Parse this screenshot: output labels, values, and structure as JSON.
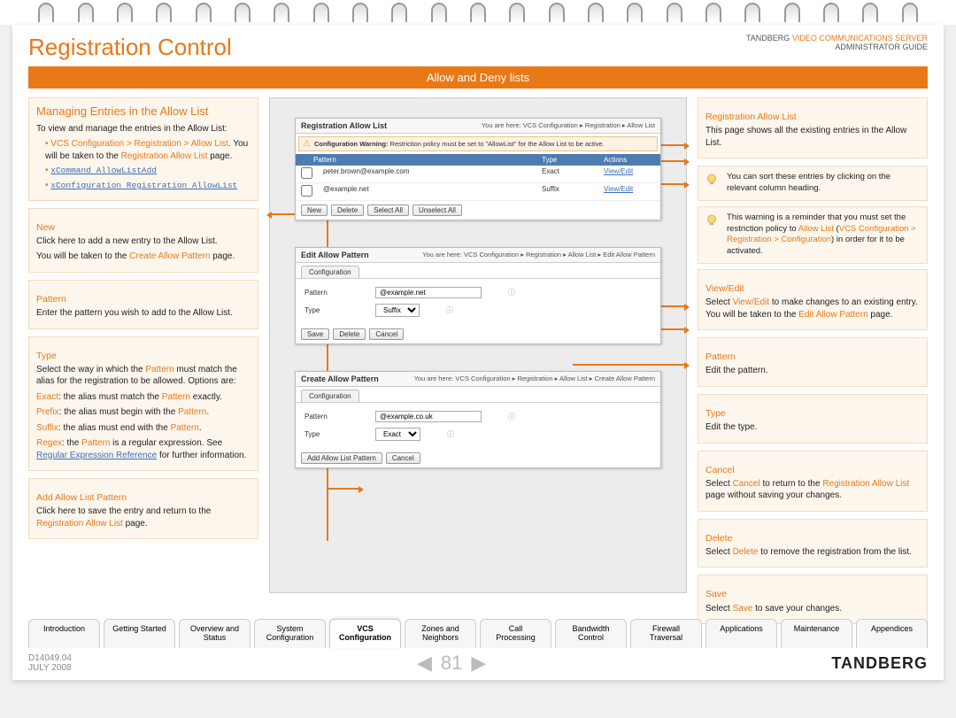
{
  "header": {
    "title": "Registration Control",
    "brand_line1_a": "TANDBERG ",
    "brand_line1_b": "VIDEO COMMUNICATIONS SERVER",
    "brand_line2": "ADMINISTRATOR GUIDE"
  },
  "bar": "Allow and Deny lists",
  "left": {
    "h": "Managing Entries in the Allow List",
    "intro": "To view and manage the entries in the Allow List:",
    "bullets": {
      "b1a": "VCS Configuration > Registration > Allow List",
      "b1b": ". You will be taken to the ",
      "b1c": "Registration Allow List",
      "b1d": " page.",
      "b2": "xCommand AllowListAdd",
      "b3": "xConfiguration Registration AllowList"
    },
    "new_h": "New",
    "new_p1": "Click here to add a new entry to the Allow List.",
    "new_p2a": "You will be taken to the ",
    "new_p2b": "Create Allow Pattern",
    "new_p2c": " page.",
    "pattern_h": "Pattern",
    "pattern_p": "Enter the pattern you wish to add to the Allow List.",
    "type_h": "Type",
    "type_p1a": "Select the way in which the ",
    "type_p1b": "Pattern",
    "type_p1c": " must match the alias for the registration to be allowed. Options are:",
    "exact_a": "Exact",
    "exact_b": ": the alias must match the ",
    "exact_c": "Pattern",
    "exact_d": " exactly.",
    "prefix_a": "Prefix",
    "prefix_b": ": the alias must begin with the ",
    "prefix_c": "Pattern",
    "prefix_d": ".",
    "suffix_a": "Suffix",
    "suffix_b": ": the alias must end with the ",
    "suffix_c": "Pattern",
    "suffix_d": ".",
    "regex_a": "Regex",
    "regex_b": ": the ",
    "regex_c": "Pattern",
    "regex_d": " is a regular expression. See ",
    "regex_link": "Regular Expression Reference",
    "regex_e": " for further information.",
    "add_h": "Add Allow List Pattern",
    "add_p1": "Click here to save the entry and return to the ",
    "add_p2": "Registration Allow List",
    "add_p3": " page."
  },
  "right": {
    "h": "Registration Allow List",
    "p1": "This page shows all the existing entries in the Allow List.",
    "tip1": "You can sort these entries by clicking on the relevant column heading.",
    "tip2a": "This warning is a reminder that you must set the restriction policy to ",
    "tip2b": "Allow List",
    "tip2c": " (",
    "tip2d": "VCS Configuration > Registration > Configuration",
    "tip2e": ") in order for it to be activated.",
    "ve_h": "View/Edit",
    "ve_a": "Select ",
    "ve_b": "View/Edit",
    "ve_c": " to make changes to an existing entry. You will be taken to the ",
    "ve_d": "Edit Allow Pattern",
    "ve_e": " page.",
    "pat_h": "Pattern",
    "pat_p": "Edit the pattern.",
    "typ_h": "Type",
    "typ_p": "Edit the type.",
    "can_h": "Cancel",
    "can_a": "Select ",
    "can_b": "Cancel",
    "can_c": " to return to the ",
    "can_d": "Registration Allow List",
    "can_e": " page without saving your changes.",
    "del_h": "Delete",
    "del_a": "Select ",
    "del_b": "Delete",
    "del_c": " to remove the registration from the list.",
    "sav_h": "Save",
    "sav_a": "Select ",
    "sav_b": "Save",
    "sav_c": " to save your changes."
  },
  "mid": {
    "p1": {
      "title": "Registration Allow List",
      "crumb": "You are here: VCS Configuration ▸ Registration ▸ Allow List",
      "warn_label": "Configuration Warning:",
      "warn_text": " Restriction policy must be set to \"AllowList\" for the Allow List to be active.",
      "th_pattern": "Pattern",
      "th_type": "Type",
      "th_actions": "Actions",
      "r1_p": "peter.brown@example.com",
      "r1_t": "Exact",
      "r1_a": "View/Edit",
      "r2_p": "@example.net",
      "r2_t": "Suffix",
      "r2_a": "View/Edit",
      "btn_new": "New",
      "btn_del": "Delete",
      "btn_sa": "Select All",
      "btn_ua": "Unselect All"
    },
    "p2": {
      "title": "Edit Allow Pattern",
      "crumb": "You are here: VCS Configuration ▸ Registration ▸ Allow List ▸ Edit Allow Pattern",
      "tab": "Configuration",
      "lbl_pat": "Pattern",
      "val_pat": "@example.net",
      "lbl_typ": "Type",
      "val_typ": "Suffix",
      "btn_save": "Save",
      "btn_del": "Delete",
      "btn_can": "Cancel"
    },
    "p3": {
      "title": "Create Allow Pattern",
      "crumb": "You are here: VCS Configuration ▸ Registration ▸ Allow List ▸ Create Allow Pattern",
      "tab": "Configuration",
      "lbl_pat": "Pattern",
      "val_pat": "@example.co.uk",
      "lbl_typ": "Type",
      "val_typ": "Exact",
      "btn_add": "Add Allow List Pattern",
      "btn_can": "Cancel"
    }
  },
  "nav": {
    "t1": "Introduction",
    "t2": "Getting Started",
    "t3a": "Overview and",
    "t3b": "Status",
    "t4a": "System",
    "t4b": "Configuration",
    "t5a": "VCS",
    "t5b": "Configuration",
    "t6a": "Zones and",
    "t6b": "Neighbors",
    "t7a": "Call",
    "t7b": "Processing",
    "t8a": "Bandwidth",
    "t8b": "Control",
    "t9a": "Firewall",
    "t9b": "Traversal",
    "t10": "Applications",
    "t11": "Maintenance",
    "t12": "Appendices"
  },
  "footer": {
    "doc": "D14049.04",
    "date": "JULY 2008",
    "page": "81",
    "brand": "TANDBERG"
  }
}
